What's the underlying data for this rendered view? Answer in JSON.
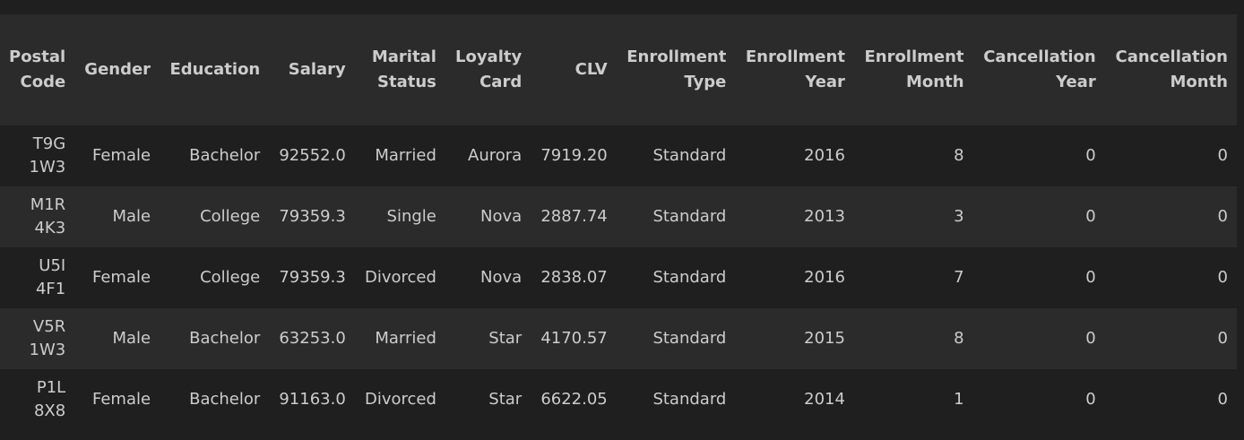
{
  "table": {
    "headers": [
      [
        "Postal",
        "Code"
      ],
      [
        "Gender"
      ],
      [
        "Education"
      ],
      [
        "Salary"
      ],
      [
        "Marital",
        "Status"
      ],
      [
        "Loyalty",
        "Card"
      ],
      [
        "CLV"
      ],
      [
        "Enrollment",
        "Type"
      ],
      [
        "Enrollment",
        "Year"
      ],
      [
        "Enrollment",
        "Month"
      ],
      [
        "Cancellation",
        "Year"
      ],
      [
        "Cancellation",
        "Month"
      ]
    ],
    "rows": [
      {
        "postal_code": [
          "T9G",
          "1W3"
        ],
        "gender": "Female",
        "education": "Bachelor",
        "salary": "92552.0",
        "marital_status": "Married",
        "loyalty_card": "Aurora",
        "clv": "7919.20",
        "enrollment_type": "Standard",
        "enrollment_year": "2016",
        "enrollment_month": "8",
        "cancellation_year": "0",
        "cancellation_month": "0"
      },
      {
        "postal_code": [
          "M1R",
          "4K3"
        ],
        "gender": "Male",
        "education": "College",
        "salary": "79359.3",
        "marital_status": "Single",
        "loyalty_card": "Nova",
        "clv": "2887.74",
        "enrollment_type": "Standard",
        "enrollment_year": "2013",
        "enrollment_month": "3",
        "cancellation_year": "0",
        "cancellation_month": "0"
      },
      {
        "postal_code": [
          "U5I",
          "4F1"
        ],
        "gender": "Female",
        "education": "College",
        "salary": "79359.3",
        "marital_status": "Divorced",
        "loyalty_card": "Nova",
        "clv": "2838.07",
        "enrollment_type": "Standard",
        "enrollment_year": "2016",
        "enrollment_month": "7",
        "cancellation_year": "0",
        "cancellation_month": "0"
      },
      {
        "postal_code": [
          "V5R",
          "1W3"
        ],
        "gender": "Male",
        "education": "Bachelor",
        "salary": "63253.0",
        "marital_status": "Married",
        "loyalty_card": "Star",
        "clv": "4170.57",
        "enrollment_type": "Standard",
        "enrollment_year": "2015",
        "enrollment_month": "8",
        "cancellation_year": "0",
        "cancellation_month": "0"
      },
      {
        "postal_code": [
          "P1L",
          "8X8"
        ],
        "gender": "Female",
        "education": "Bachelor",
        "salary": "91163.0",
        "marital_status": "Divorced",
        "loyalty_card": "Star",
        "clv": "6622.05",
        "enrollment_type": "Standard",
        "enrollment_year": "2014",
        "enrollment_month": "1",
        "cancellation_year": "0",
        "cancellation_month": "0"
      }
    ]
  },
  "colors": {
    "background": "#1f1f1f",
    "stripe": "#2b2b2b",
    "text": "#cccccc"
  }
}
